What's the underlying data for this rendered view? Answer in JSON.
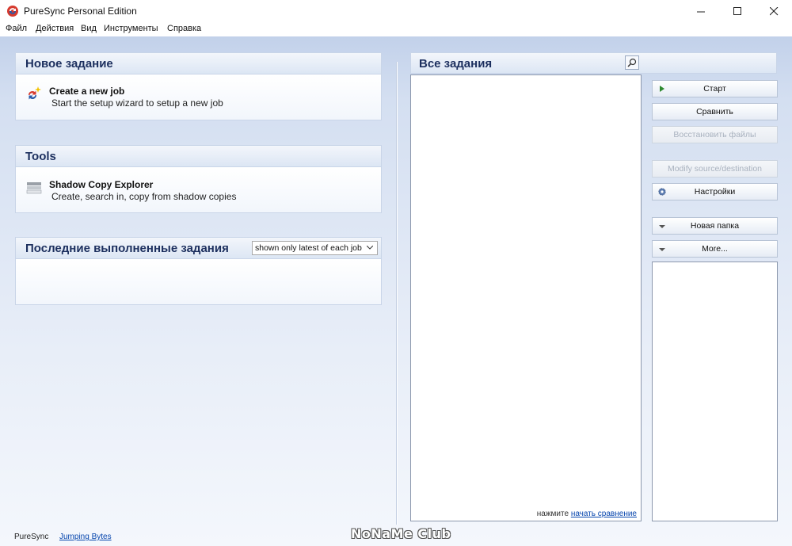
{
  "window": {
    "title": "PureSync Personal Edition"
  },
  "menu": [
    "Файл",
    "Действия",
    "Вид",
    "Инструменты",
    "Справка"
  ],
  "new_job_panel": {
    "header": "Новое задание",
    "item_title": "Create a new job",
    "item_subtitle": "Start the setup wizard to setup a new job"
  },
  "tools_panel": {
    "header": "Tools",
    "item_title": "Shadow Copy Explorer",
    "item_subtitle": "Create, search in, copy from shadow copies"
  },
  "recent_panel": {
    "header": "Последние выполненные задания",
    "filter_value": "shown only latest of each job"
  },
  "jobs_panel": {
    "header": "Все задания",
    "hint_text": "нажмите",
    "hint_link": "начать сравнение"
  },
  "buttons": {
    "start": "Старт",
    "compare": "Сравнить",
    "restore": "Восстановить файлы",
    "modify": "Modify source/destination",
    "settings": "Настройки",
    "new_folder": "Новая папка",
    "more": "More..."
  },
  "status": {
    "app": "PureSync",
    "link": "Jumping Bytes"
  },
  "watermark": "NoNaMe Club",
  "colors": {
    "header_text": "#1c2f5e",
    "link": "#0645ad",
    "start_arrow": "#2f8a2f"
  }
}
